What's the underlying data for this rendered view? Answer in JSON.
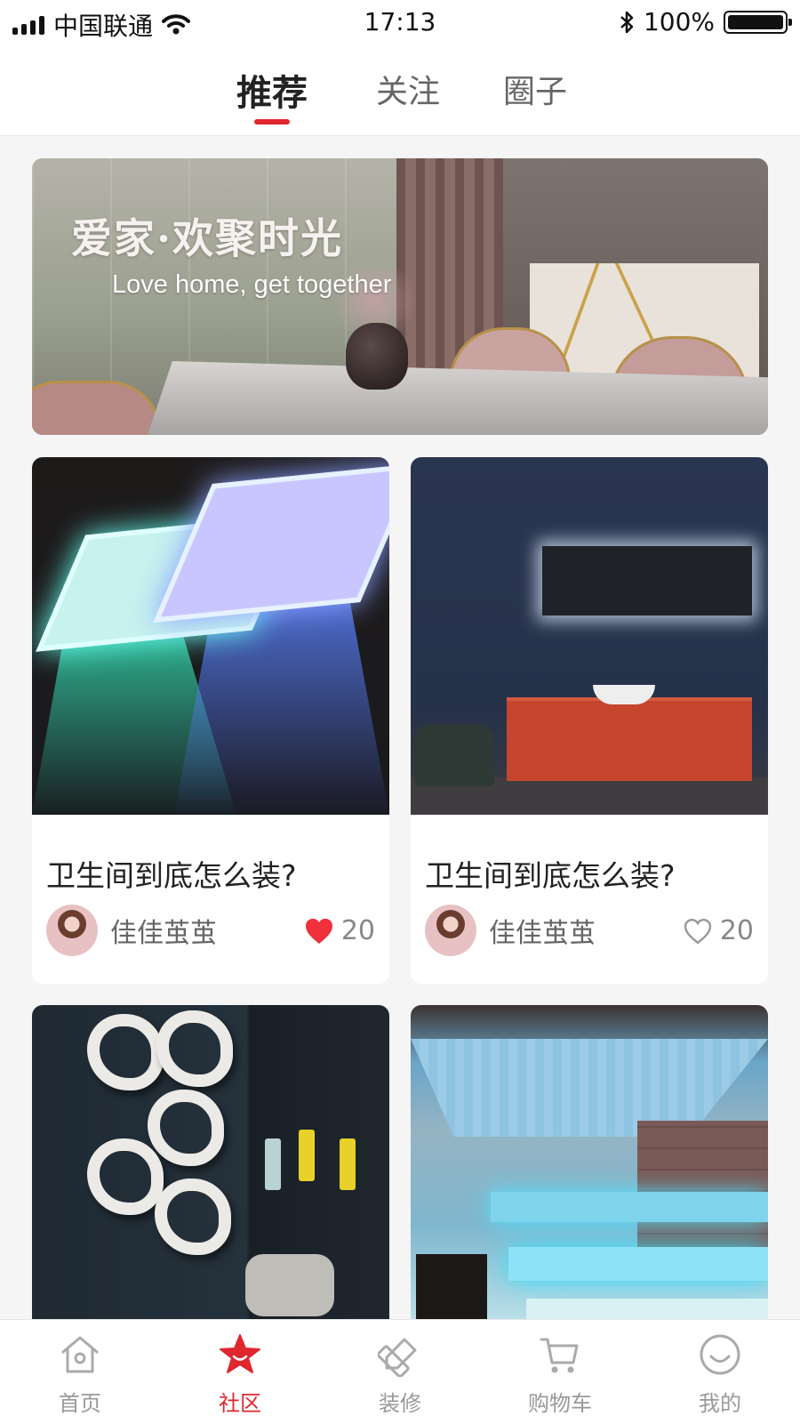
{
  "status_bar": {
    "carrier": "中国联通",
    "time": "17:13",
    "battery": "100%"
  },
  "tabs": [
    {
      "label": "推荐",
      "active": true
    },
    {
      "label": "关注",
      "active": false
    },
    {
      "label": "圈子",
      "active": false
    }
  ],
  "banner": {
    "title": "爱家·欢聚时光",
    "subtitle": "Love home, get together"
  },
  "feed": [
    {
      "title": "卫生间到底怎么装?",
      "author": "佳佳茧茧",
      "likes": "20",
      "liked": true
    },
    {
      "title": "卫生间到底怎么装?",
      "author": "佳佳茧茧",
      "likes": "20",
      "liked": false
    }
  ],
  "bottom_nav": [
    {
      "label": "首页",
      "icon": "home-icon",
      "active": false
    },
    {
      "label": "社区",
      "icon": "star-icon",
      "active": true
    },
    {
      "label": "装修",
      "icon": "decor-icon",
      "active": false
    },
    {
      "label": "购物车",
      "icon": "cart-icon",
      "active": false
    },
    {
      "label": "我的",
      "icon": "profile-icon",
      "active": false
    }
  ],
  "colors": {
    "accent": "#e0262f",
    "like": "#f0303a",
    "inactive": "#999999"
  }
}
